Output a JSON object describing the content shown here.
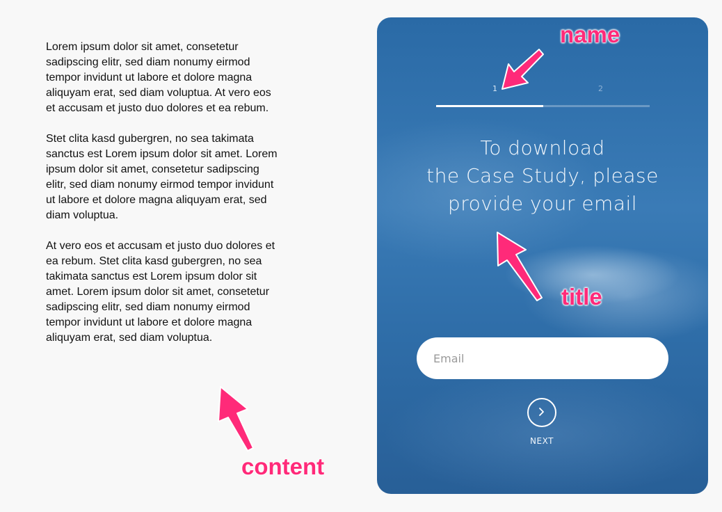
{
  "content": {
    "paragraphs": [
      "Lorem ipsum dolor sit amet, consetetur sadipscing elitr, sed diam nonumy eirmod tempor invidunt ut labore et dolore magna aliquyam erat, sed diam voluptua. At vero eos et accusam et justo duo dolores et ea rebum.",
      "Stet clita kasd gubergren, no sea takimata sanctus est Lorem ipsum dolor sit amet. Lorem ipsum dolor sit amet, consetetur sadipscing elitr, sed diam nonumy eirmod tempor invidunt ut labore et dolore magna aliquyam erat, sed diam voluptua.",
      "At vero eos et accusam et justo duo dolores et ea rebum. Stet clita kasd gubergren, no sea takimata sanctus est Lorem ipsum dolor sit amet. Lorem ipsum dolor sit amet, consetetur sadipscing elitr, sed diam nonumy eirmod tempor invidunt ut labore et dolore magna aliquyam erat, sed diam voluptua."
    ]
  },
  "form": {
    "steps": [
      {
        "label": "1",
        "active": true
      },
      {
        "label": "2",
        "active": false
      }
    ],
    "progress_fraction": 0.5,
    "title_lines": [
      "To download",
      "the Case Study, please",
      "provide your email"
    ],
    "email_placeholder": "Email",
    "email_value": "",
    "next_label": "NEXT",
    "next_icon": "chevron-right-icon"
  },
  "annotations": {
    "name": "name",
    "title": "title",
    "content": "content",
    "color": "#ff2a79"
  }
}
